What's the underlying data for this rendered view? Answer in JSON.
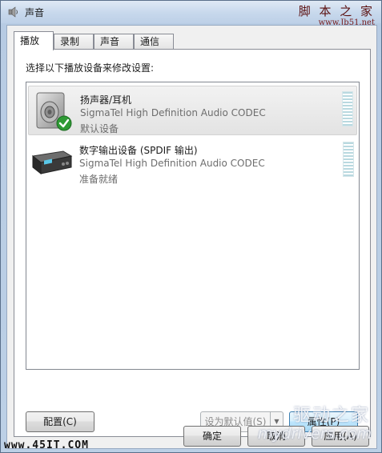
{
  "window": {
    "title": "声音",
    "watermark_top_cn": "脚 本 之 家",
    "watermark_top_url": "www.Jb51.net"
  },
  "tabs": [
    {
      "label": "播放",
      "active": true
    },
    {
      "label": "录制",
      "active": false
    },
    {
      "label": "声音",
      "active": false
    },
    {
      "label": "通信",
      "active": false
    }
  ],
  "playback": {
    "prompt": "选择以下播放设备来修改设置:",
    "devices": [
      {
        "name": "扬声器/耳机",
        "driver": "SigmaTel High Definition Audio CODEC",
        "status": "默认设备",
        "icon": "speaker-icon",
        "is_default": true
      },
      {
        "name": "数字输出设备 (SPDIF 输出)",
        "driver": "SigmaTel High Definition Audio CODEC",
        "status": "准备就绪",
        "icon": "digital-output-icon",
        "is_default": false
      }
    ]
  },
  "buttons": {
    "configure": "配置(C)",
    "set_default": "设为默认值(S)",
    "properties": "属性(P)",
    "ok": "确定",
    "cancel": "取消",
    "apply": "应用(A)"
  },
  "watermarks": {
    "bottom_left": "www.45IT.COM",
    "bottom_right_cn": "驱动之家",
    "bottom_right_url": "mydrivers.com"
  },
  "colors": {
    "selection": "#e3e3e3",
    "default_button": "#3c7fb1",
    "meter": "#b9d9e0"
  }
}
